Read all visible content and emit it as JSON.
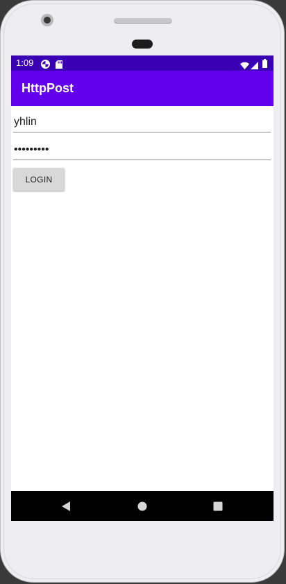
{
  "status_bar": {
    "time": "1:09"
  },
  "app_bar": {
    "title": "HttpPost"
  },
  "form": {
    "username_value": "yhlin",
    "password_value": "password1",
    "login_label": "LOGIN"
  },
  "colors": {
    "status_bar": "#3a00b3",
    "app_bar": "#6200ee",
    "button": "#d8d8d8",
    "nav_bar": "#000000"
  },
  "icons": {
    "status_left": [
      "data-saver-icon",
      "sd-card-icon"
    ],
    "status_right": [
      "wifi-icon",
      "cellular-signal-icon",
      "battery-icon"
    ],
    "navigation": [
      "back-icon",
      "home-icon",
      "recents-icon"
    ]
  }
}
